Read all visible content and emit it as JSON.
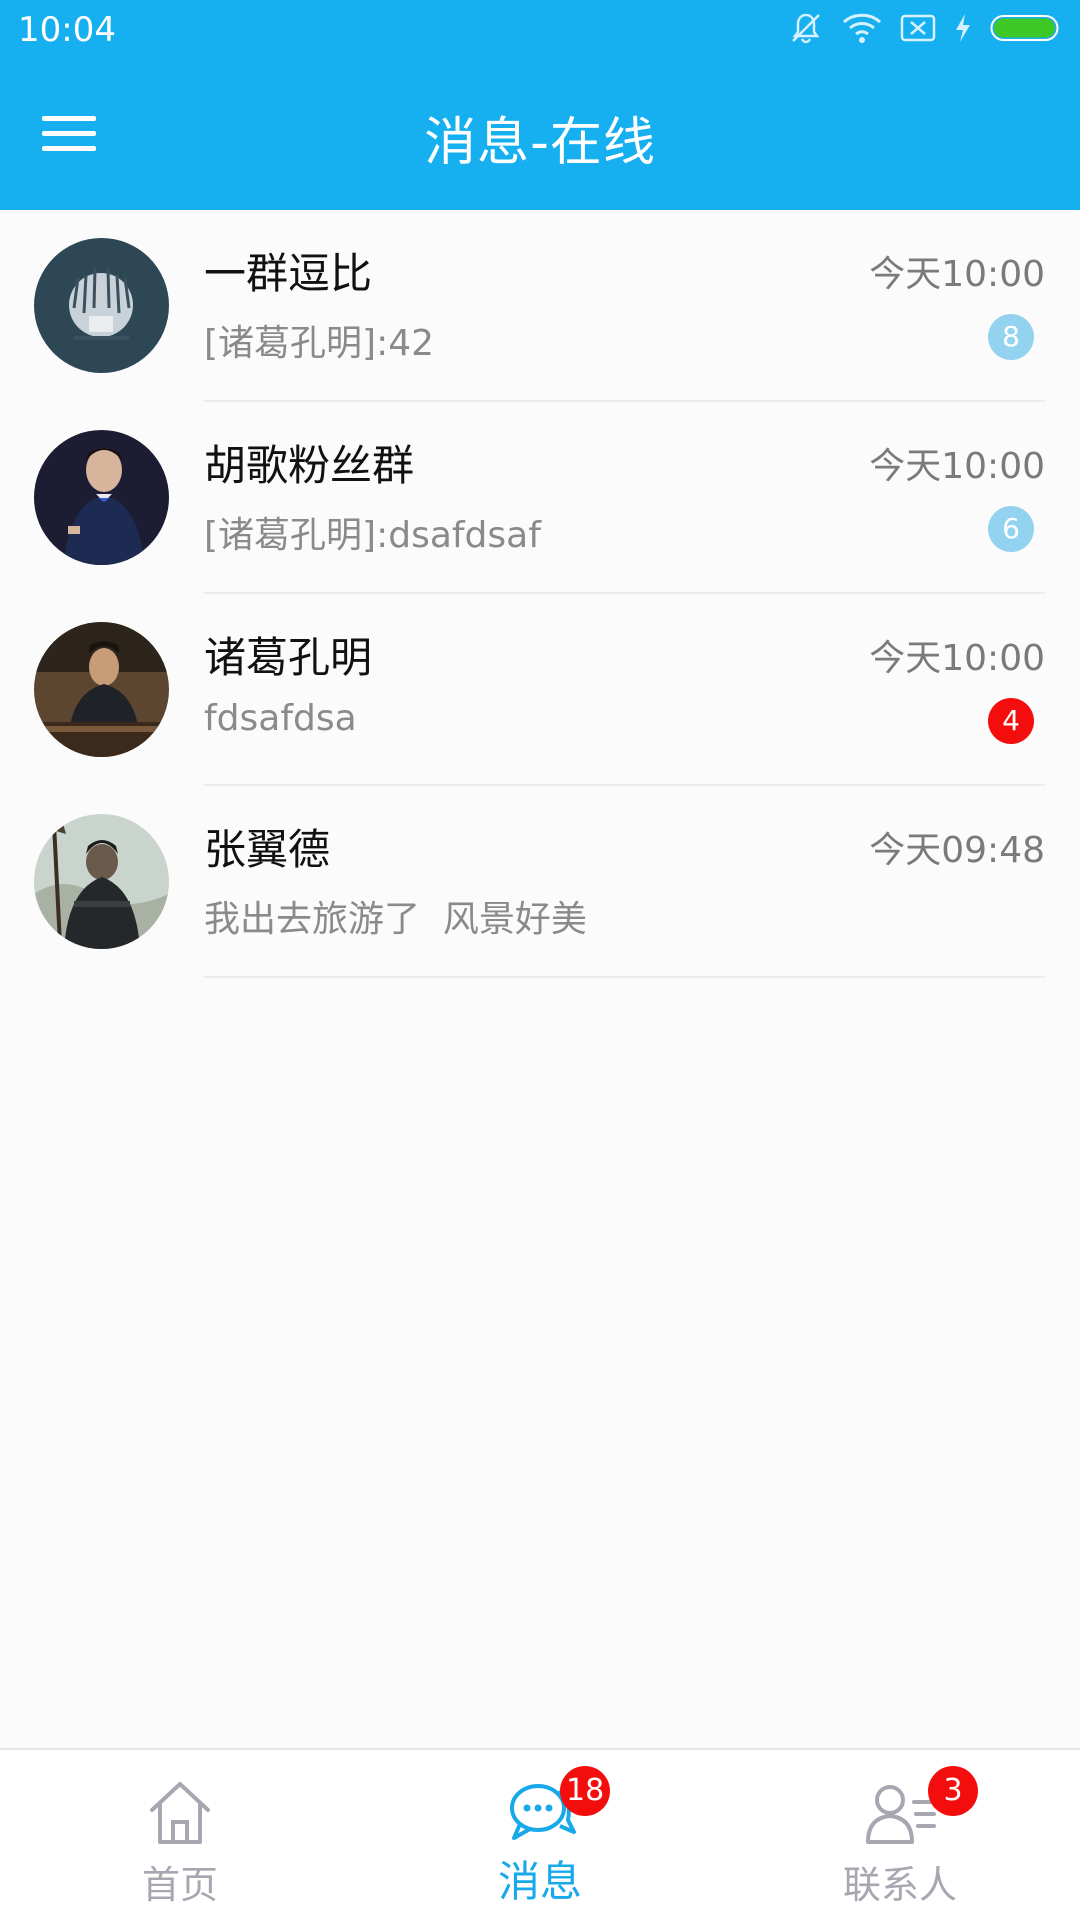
{
  "status_bar": {
    "time": "10:04",
    "icons": [
      "mute-icon",
      "wifi-icon",
      "no-sim-icon",
      "charging-icon",
      "battery-icon"
    ],
    "battery_color": "#3ec826"
  },
  "app_bar": {
    "title": "消息-在线",
    "background": "#16aff0"
  },
  "conversations": [
    {
      "name": "一群逗比",
      "time": "今天10:00",
      "preview": "[诸葛孔明]:42",
      "unread": "8",
      "badge_style": "light",
      "avatar": "group-avatar"
    },
    {
      "name": "胡歌粉丝群",
      "time": "今天10:00",
      "preview": "[诸葛孔明]:dsafdsaf",
      "unread": "6",
      "badge_style": "light",
      "avatar": "group-avatar"
    },
    {
      "name": "诸葛孔明",
      "time": "今天10:00",
      "preview": "fdsafdsa",
      "unread": "4",
      "badge_style": "red",
      "avatar": "user-avatar"
    },
    {
      "name": "张翼德",
      "time": "今天09:48",
      "preview": "我出去旅游了  风景好美",
      "unread": null,
      "badge_style": null,
      "avatar": "user-avatar"
    }
  ],
  "bottom_nav": {
    "items": [
      {
        "label": "首页",
        "icon": "home-icon",
        "active": false,
        "badge": null
      },
      {
        "label": "消息",
        "icon": "chat-icon",
        "active": true,
        "badge": "18"
      },
      {
        "label": "联系人",
        "icon": "contacts-icon",
        "active": false,
        "badge": "3"
      }
    ],
    "active_color": "#18a9ea",
    "inactive_color": "#a7a7b2"
  }
}
